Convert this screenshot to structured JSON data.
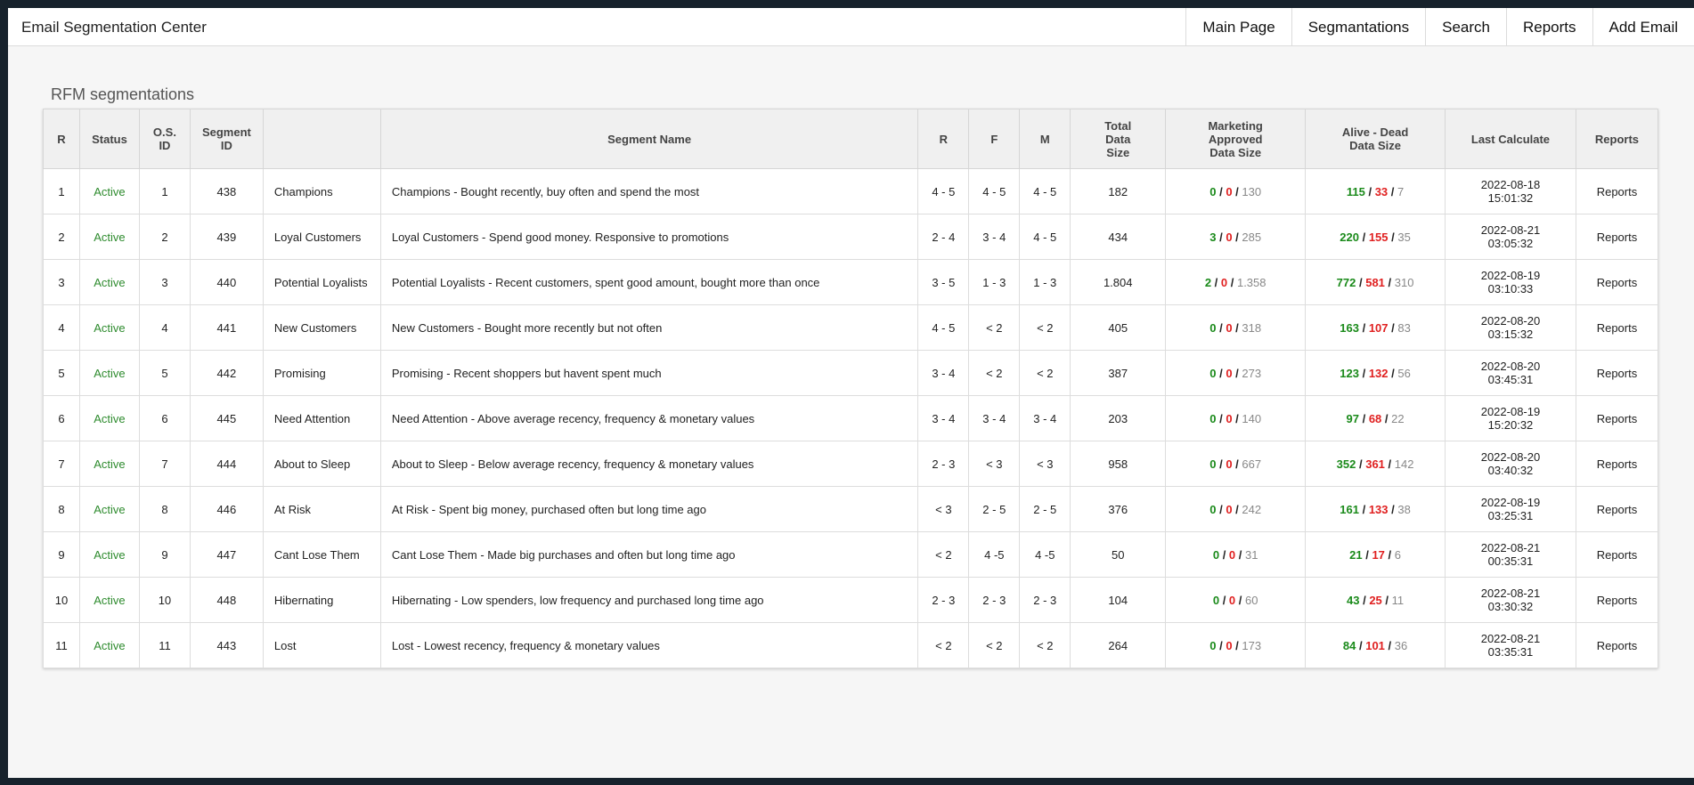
{
  "app": {
    "title": "Email Segmentation Center"
  },
  "nav": [
    {
      "label": "Main Page"
    },
    {
      "label": "Segmantations"
    },
    {
      "label": "Search"
    },
    {
      "label": "Reports"
    },
    {
      "label": "Add Email"
    }
  ],
  "page": {
    "title": "RFM segmentations"
  },
  "columns": {
    "r": "R",
    "status": "Status",
    "os_id_1": "O.S.",
    "os_id_2": "ID",
    "seg_id_1": "Segment",
    "seg_id_2": "ID",
    "name_short": "",
    "segment_name": "Segment Name",
    "rr": "R",
    "f": "F",
    "m": "M",
    "total_1": "Total",
    "total_2": "Data",
    "total_3": "Size",
    "mkt_1": "Marketing",
    "mkt_2": "Approved",
    "mkt_3": "Data Size",
    "alive_1": "Alive - Dead",
    "alive_2": "Data Size",
    "last_calc": "Last Calculate",
    "reports": "Reports"
  },
  "colors": {
    "green": "#1a8a1a",
    "red": "#e02020",
    "gray": "#888888",
    "status_green": "#2e8b2e"
  },
  "rows": [
    {
      "r": "1",
      "status": "Active",
      "os_id": "1",
      "seg_id": "438",
      "name": "Champions",
      "desc": "Champions - Bought recently, buy often and spend the most",
      "rr": "4 - 5",
      "f": "4 - 5",
      "m": "4 - 5",
      "total": "182",
      "mk_g": "0",
      "mk_r": "0",
      "mk_k": "130",
      "al_g": "115",
      "al_r": "33",
      "al_k": "7",
      "date": "2022-08-18",
      "time": "15:01:32",
      "report": "Reports"
    },
    {
      "r": "2",
      "status": "Active",
      "os_id": "2",
      "seg_id": "439",
      "name": "Loyal Customers",
      "desc": "Loyal Customers - Spend good money. Responsive to promotions",
      "rr": "2 - 4",
      "f": "3 - 4",
      "m": "4 - 5",
      "total": "434",
      "mk_g": "3",
      "mk_r": "0",
      "mk_k": "285",
      "al_g": "220",
      "al_r": "155",
      "al_k": "35",
      "date": "2022-08-21",
      "time": "03:05:32",
      "report": "Reports"
    },
    {
      "r": "3",
      "status": "Active",
      "os_id": "3",
      "seg_id": "440",
      "name": "Potential Loyalists",
      "desc": "Potential Loyalists - Recent customers, spent good amount, bought more than once",
      "rr": "3 - 5",
      "f": "1 - 3",
      "m": "1 - 3",
      "total": "1.804",
      "mk_g": "2",
      "mk_r": "0",
      "mk_k": "1.358",
      "al_g": "772",
      "al_r": "581",
      "al_k": "310",
      "date": "2022-08-19",
      "time": "03:10:33",
      "report": "Reports"
    },
    {
      "r": "4",
      "status": "Active",
      "os_id": "4",
      "seg_id": "441",
      "name": "New Customers",
      "desc": "New Customers - Bought more recently but not often",
      "rr": "4 - 5",
      "f": "< 2",
      "m": "< 2",
      "total": "405",
      "mk_g": "0",
      "mk_r": "0",
      "mk_k": "318",
      "al_g": "163",
      "al_r": "107",
      "al_k": "83",
      "date": "2022-08-20",
      "time": "03:15:32",
      "report": "Reports"
    },
    {
      "r": "5",
      "status": "Active",
      "os_id": "5",
      "seg_id": "442",
      "name": "Promising",
      "desc": "Promising - Recent shoppers but havent spent much",
      "rr": "3 - 4",
      "f": "< 2",
      "m": "< 2",
      "total": "387",
      "mk_g": "0",
      "mk_r": "0",
      "mk_k": "273",
      "al_g": "123",
      "al_r": "132",
      "al_k": "56",
      "date": "2022-08-20",
      "time": "03:45:31",
      "report": "Reports"
    },
    {
      "r": "6",
      "status": "Active",
      "os_id": "6",
      "seg_id": "445",
      "name": "Need Attention",
      "desc": "Need Attention - Above average recency, frequency & monetary values",
      "rr": "3 - 4",
      "f": "3 - 4",
      "m": "3 - 4",
      "total": "203",
      "mk_g": "0",
      "mk_r": "0",
      "mk_k": "140",
      "al_g": "97",
      "al_r": "68",
      "al_k": "22",
      "date": "2022-08-19",
      "time": "15:20:32",
      "report": "Reports"
    },
    {
      "r": "7",
      "status": "Active",
      "os_id": "7",
      "seg_id": "444",
      "name": "About to Sleep",
      "desc": "About to Sleep - Below average recency, frequency & monetary values",
      "rr": "2 - 3",
      "f": "< 3",
      "m": "< 3",
      "total": "958",
      "mk_g": "0",
      "mk_r": "0",
      "mk_k": "667",
      "al_g": "352",
      "al_r": "361",
      "al_k": "142",
      "date": "2022-08-20",
      "time": "03:40:32",
      "report": "Reports"
    },
    {
      "r": "8",
      "status": "Active",
      "os_id": "8",
      "seg_id": "446",
      "name": "At Risk",
      "desc": "At Risk - Spent big money, purchased often but long time ago",
      "rr": "< 3",
      "f": "2 - 5",
      "m": "2 - 5",
      "total": "376",
      "mk_g": "0",
      "mk_r": "0",
      "mk_k": "242",
      "al_g": "161",
      "al_r": "133",
      "al_k": "38",
      "date": "2022-08-19",
      "time": "03:25:31",
      "report": "Reports"
    },
    {
      "r": "9",
      "status": "Active",
      "os_id": "9",
      "seg_id": "447",
      "name": "Cant Lose Them",
      "desc": "Cant Lose Them - Made big purchases and often but long time ago",
      "rr": "< 2",
      "f": "4 -5",
      "m": "4 -5",
      "total": "50",
      "mk_g": "0",
      "mk_r": "0",
      "mk_k": "31",
      "al_g": "21",
      "al_r": "17",
      "al_k": "6",
      "date": "2022-08-21",
      "time": "00:35:31",
      "report": "Reports"
    },
    {
      "r": "10",
      "status": "Active",
      "os_id": "10",
      "seg_id": "448",
      "name": "Hibernating",
      "desc": "Hibernating - Low spenders, low frequency and purchased long time ago",
      "rr": "2 - 3",
      "f": "2 - 3",
      "m": "2 - 3",
      "total": "104",
      "mk_g": "0",
      "mk_r": "0",
      "mk_k": "60",
      "al_g": "43",
      "al_r": "25",
      "al_k": "11",
      "date": "2022-08-21",
      "time": "03:30:32",
      "report": "Reports"
    },
    {
      "r": "11",
      "status": "Active",
      "os_id": "11",
      "seg_id": "443",
      "name": "Lost",
      "desc": "Lost - Lowest recency, frequency & monetary values",
      "rr": "< 2",
      "f": "< 2",
      "m": "< 2",
      "total": "264",
      "mk_g": "0",
      "mk_r": "0",
      "mk_k": "173",
      "al_g": "84",
      "al_r": "101",
      "al_k": "36",
      "date": "2022-08-21",
      "time": "03:35:31",
      "report": "Reports"
    }
  ]
}
